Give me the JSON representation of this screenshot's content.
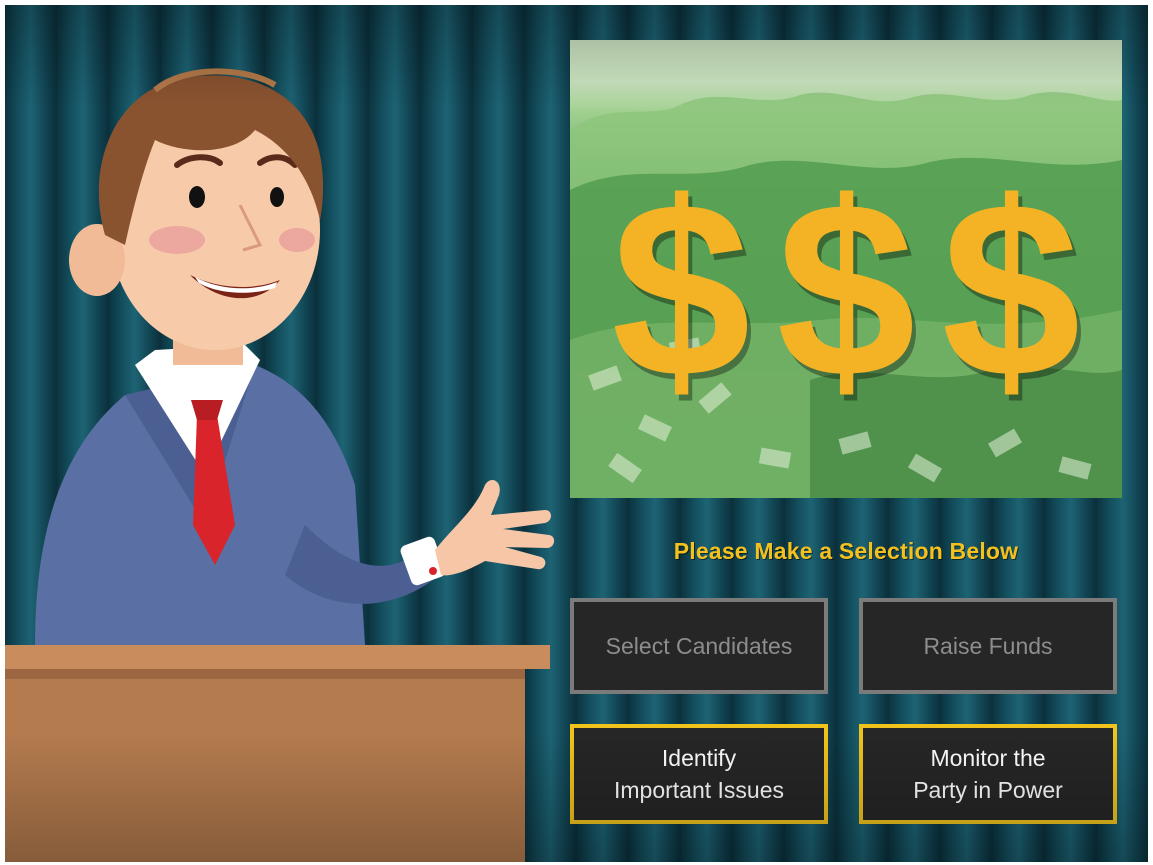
{
  "screen": {
    "prompt": "Please Make a Selection Below",
    "panel_symbols": [
      "$",
      "$",
      "$"
    ],
    "panel_image": "money-pile-dollar-signs"
  },
  "buttons": [
    {
      "id": "select_candidates",
      "lines": [
        "Select Candidates"
      ],
      "state": "disabled"
    },
    {
      "id": "raise_funds",
      "lines": [
        "Raise Funds"
      ],
      "state": "disabled"
    },
    {
      "id": "identify_issues",
      "lines": [
        "Identify",
        "Important Issues"
      ],
      "state": "enabled"
    },
    {
      "id": "monitor_party",
      "lines": [
        "Monitor the",
        "Party in Power"
      ],
      "state": "enabled"
    }
  ],
  "colors": {
    "curtain": "#14505f",
    "accent_yellow": "#f0c21c",
    "dollar_gold": "#f4b324",
    "button_bg": "#262626",
    "disabled_border": "#7b7b7b"
  }
}
